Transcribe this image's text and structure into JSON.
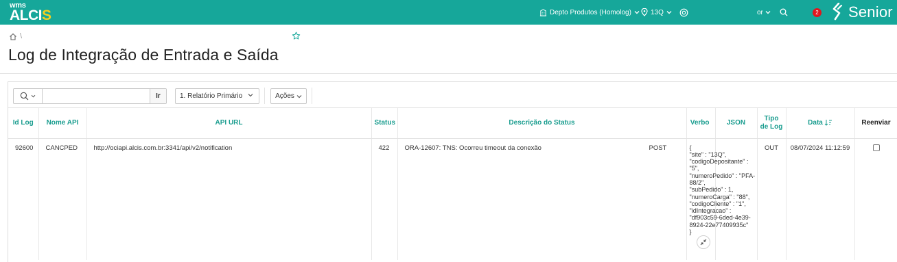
{
  "header": {
    "logo_top": "wms",
    "logo_main_a": "ALCI",
    "logo_main_b": "S",
    "department": "Depto Produtos (Homolog)",
    "location": "13Q",
    "user_suffix": "or",
    "notifications_count": "2",
    "brand": "Senior",
    "colors": {
      "bar": "#16a79a",
      "accent_yellow": "#f5d020",
      "badge": "#e0161e"
    }
  },
  "page": {
    "breadcrumb_sep": "\\",
    "title": "Log de Integração de Entrada e Saída"
  },
  "toolbar": {
    "search_value": "",
    "go_label": "Ir",
    "report_select": "1. Relatório Primário",
    "actions_label": "Ações"
  },
  "table": {
    "columns": {
      "id_log": "Id Log",
      "nome_api": "Nome API",
      "api_url": "API URL",
      "status": "Status",
      "descricao": "Descrição do Status",
      "verbo": "Verbo",
      "json": "JSON",
      "tipo_log": "Tipo de Log",
      "data": "Data",
      "reenviar": "Reenviar"
    },
    "rows": [
      {
        "id_log": "92600",
        "nome_api": "CANCPED",
        "api_url": "http://ociapi.alcis.com.br:3341/api/v2/notification",
        "status": "422",
        "descricao": "ORA-12607: TNS: Ocorreu timeout da conexão",
        "verbo": "POST",
        "json": "{\n\"site\" : \"13Q\",\n\"codigoDepositante\" :\n\"5\",\n\"numeroPedido\" : \"PFA-\n88/2\",\n\"subPedido\" : 1,\n\"numeroCarga\" : \"88\",\n\"codigoCliente\" : \"1\",\n\"idIntegracao\" :\n\"df903c59-6ded-4e39-\n8924-22e77409935c\"\n}",
        "tipo_log": "OUT",
        "data": "08/07/2024 11:12:59",
        "reenviar": false
      }
    ]
  }
}
